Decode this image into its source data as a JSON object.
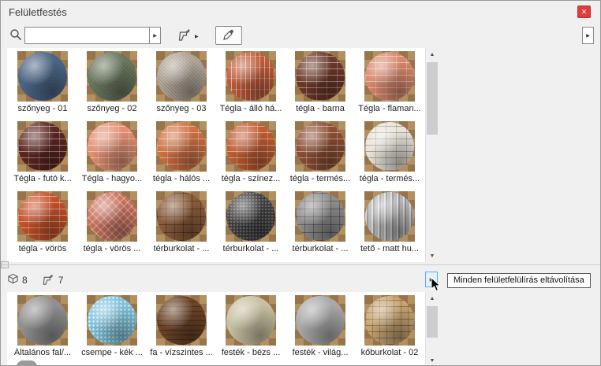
{
  "window": {
    "title": "Felületfestés",
    "close_glyph": "✕"
  },
  "icons": {
    "up": "▲",
    "down": "▼",
    "right": "▶"
  },
  "toolbar": {
    "search_value": ""
  },
  "counts": {
    "materials": "8",
    "overrides": "7"
  },
  "tooltip": {
    "text": "Minden felületfelülírás eltávolítása"
  },
  "materials_top": [
    {
      "label": "szőnyeg - 01",
      "color": "#4f6a8c",
      "pattern": "carpet"
    },
    {
      "label": "szőnyeg - 02",
      "color": "#6f7d64",
      "pattern": "carpet"
    },
    {
      "label": "szőnyeg - 03",
      "color": "#b6ab9d",
      "pattern": "carpet"
    },
    {
      "label": "Tégla - álló há...",
      "color": "#c05a38",
      "pattern": "vbrick"
    },
    {
      "label": "tégla - barna",
      "color": "#6d3829",
      "pattern": "brick"
    },
    {
      "label": "Tégla - flaman...",
      "color": "#d8886c",
      "pattern": "brick"
    },
    {
      "label": "Tégla - futó k...",
      "color": "#5d2620",
      "pattern": "brick"
    },
    {
      "label": "Tégla - hagyo...",
      "color": "#e28f72",
      "pattern": "brick"
    },
    {
      "label": "tégla - hálós ...",
      "color": "#cf7140",
      "pattern": "brick"
    },
    {
      "label": "tégla - színez...",
      "color": "#c25c30",
      "pattern": "brick"
    },
    {
      "label": "tégla - termés...",
      "color": "#8d4e34",
      "pattern": "brick"
    },
    {
      "label": "tégla - termés...",
      "color": "#e9e4da",
      "pattern": "brickdark"
    },
    {
      "label": "tégla - vörös",
      "color": "#c65128",
      "pattern": "brick"
    },
    {
      "label": "tégla - vörös ...",
      "color": "#c9705c",
      "pattern": "herringbone"
    },
    {
      "label": "térburkolat - ...",
      "color": "#8b5c3b",
      "pattern": "pavers"
    },
    {
      "label": "térburkolat - ...",
      "color": "#3d3d3d",
      "pattern": "asphalt"
    },
    {
      "label": "térburkolat - ...",
      "color": "#8f8f8f",
      "pattern": "pavers"
    },
    {
      "label": "tető - matt hu...",
      "color": "#b5b5b5",
      "pattern": "ribs"
    }
  ],
  "materials_bottom": [
    {
      "label": "Általános fal/...",
      "color": "#909090",
      "pattern": "plain"
    },
    {
      "label": "csempe - kék ...",
      "color": "#7cc2dc",
      "pattern": "speckle"
    },
    {
      "label": "fa - vízszintes ...",
      "color": "#6c4428",
      "pattern": "wood"
    },
    {
      "label": "festék - bézs ...",
      "color": "#c7c0a3",
      "pattern": "plain"
    },
    {
      "label": "festék - világ...",
      "color": "#a9a9a9",
      "pattern": "plain"
    },
    {
      "label": "kőburkolat - 02",
      "color": "#c8a572",
      "pattern": "stone"
    }
  ]
}
